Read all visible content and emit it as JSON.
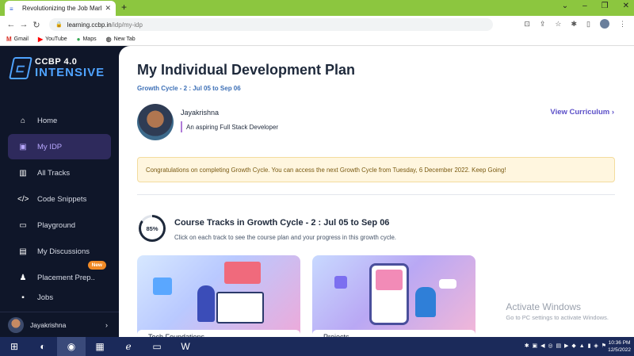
{
  "browser": {
    "tab_title": "Revolutionizing the Job Market |",
    "tab_close": "✕",
    "new_tab": "+",
    "url_host": "learning.ccbp.in",
    "url_path": "/idp/my-idp",
    "bookmarks": [
      {
        "label": "Gmail",
        "icon": "gmail-icon",
        "glyph": "M",
        "color": "#d93025"
      },
      {
        "label": "YouTube",
        "icon": "youtube-icon",
        "glyph": "▶",
        "color": "#ff0000"
      },
      {
        "label": "Maps",
        "icon": "maps-icon",
        "glyph": "●",
        "color": "#34a853"
      },
      {
        "label": "New Tab",
        "icon": "globe-icon",
        "glyph": "◍",
        "color": "#555555"
      }
    ]
  },
  "logo": {
    "line1": "CCBP 4.0",
    "line2": "INTENSIVE"
  },
  "sidebar": {
    "items": [
      {
        "label": "Home",
        "icon": "home-icon",
        "glyph": "⌂"
      },
      {
        "label": "My IDP",
        "icon": "idp-icon",
        "glyph": "▣"
      },
      {
        "label": "All Tracks",
        "icon": "book-icon",
        "glyph": "▥"
      },
      {
        "label": "Code Snippets",
        "icon": "code-icon",
        "glyph": "</>"
      },
      {
        "label": "Playground",
        "icon": "terminal-icon",
        "glyph": "▭"
      },
      {
        "label": "My Discussions",
        "icon": "chat-icon",
        "glyph": "▤"
      },
      {
        "label": "Placement Prep..",
        "icon": "person-icon",
        "glyph": "♟"
      },
      {
        "label": "Jobs",
        "icon": "briefcase-icon",
        "glyph": "▪"
      }
    ],
    "badge": "New",
    "user_name": "Jayakrishna"
  },
  "main": {
    "title": "My Individual Development Plan",
    "subtitle": "Growth Cycle - 2 : Jul 05 to Sep 06",
    "profile_name": "Jayakrishna",
    "profile_tagline": "An aspiring Full Stack Developer",
    "view_curriculum": "View Curriculum  ›",
    "notice": "Congratulations on completing Growth Cycle. You can access the next Growth Cycle from Tuesday, 6 December 2022. Keep Going!",
    "progress_label": "85%",
    "progress_value": 0.85,
    "tracks_title": "Course Tracks in Growth Cycle - 2 : Jul 05 to Sep 06",
    "tracks_subtitle": "Click on each track to see the course plan and your progress in this growth cycle.",
    "cards": [
      {
        "label": "Tech Foundations"
      },
      {
        "label": "Projects"
      }
    ]
  },
  "watermark": {
    "line1": "Activate Windows",
    "line2": "Go to PC settings to activate Windows."
  },
  "taskbar": {
    "time": "10:36 PM",
    "date": "12/5/2022"
  },
  "colors": {
    "accent": "#5b4fc8",
    "sidebar_bg": "#0f1629",
    "notice_bg": "#fff6df",
    "chrome_frame": "#8cc63f"
  }
}
